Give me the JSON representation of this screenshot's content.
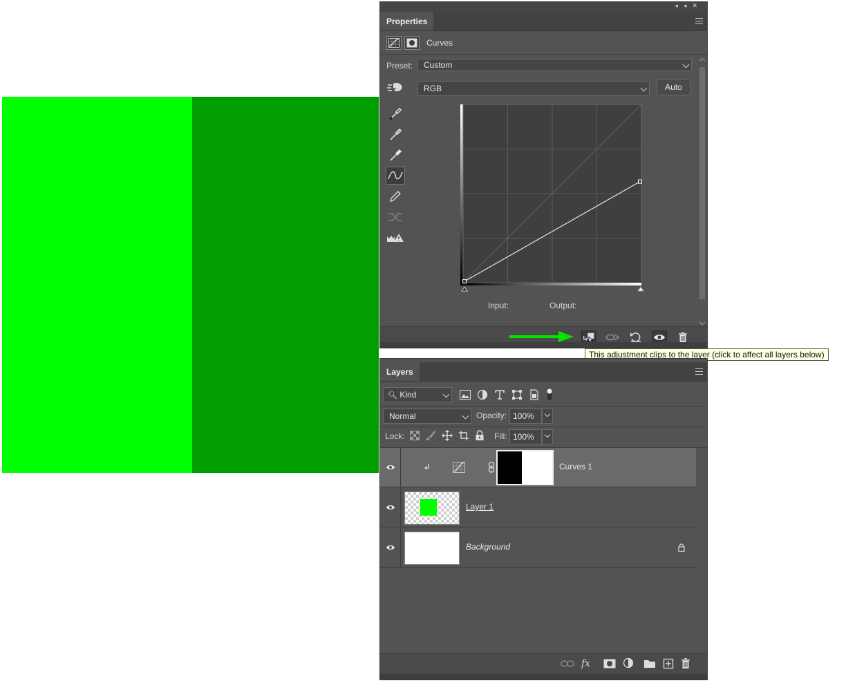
{
  "canvas": {
    "colors": {
      "light": "#00ff00",
      "dark": "#009e00"
    }
  },
  "properties": {
    "tab_label": "Properties",
    "adjustment_title": "Curves",
    "preset_label": "Preset:",
    "preset_value": "Custom",
    "channel_value": "RGB",
    "auto_label": "Auto",
    "input_label": "Input:",
    "output_label": "Output:",
    "tooltip": "This adjustment clips to the layer (click to affect all layers below)",
    "curve": {
      "input_min": 0,
      "input_max": 255,
      "points": [
        [
          0,
          0
        ],
        [
          255,
          145
        ]
      ]
    }
  },
  "layers": {
    "tab_label": "Layers",
    "filter_kind": "Kind",
    "blend_mode": "Normal",
    "opacity_label": "Opacity:",
    "opacity_value": "100%",
    "lock_label": "Lock:",
    "fill_label": "Fill:",
    "fill_value": "100%",
    "rows": [
      {
        "name": "Curves 1",
        "selected": true
      },
      {
        "name": "Layer 1",
        "selected": false
      },
      {
        "name": "Background",
        "selected": false
      }
    ]
  }
}
